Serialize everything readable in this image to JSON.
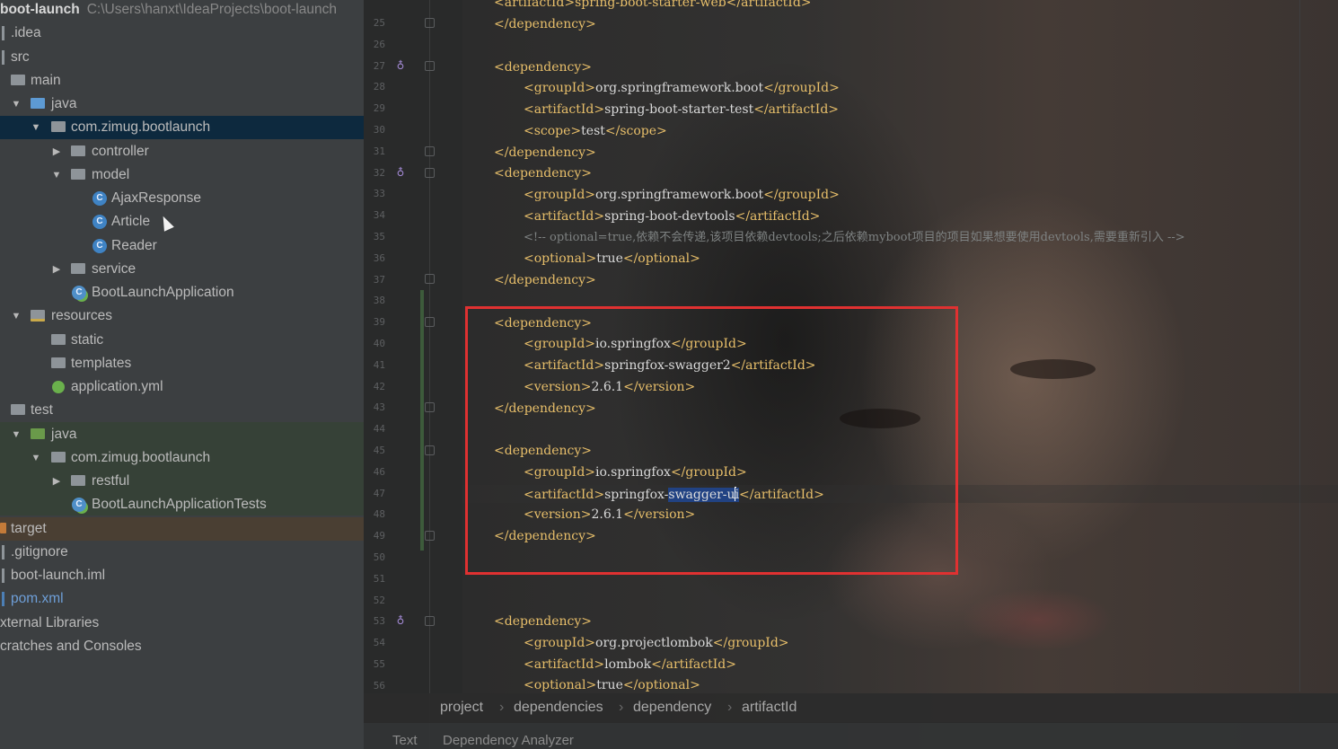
{
  "tree": {
    "root_name": "boot-launch",
    "root_path": "C:\\Users\\hanxt\\IdeaProjects\\boot-launch",
    "items": [
      {
        "label": "Idea",
        "display": ".idea"
      },
      {
        "label": "src"
      },
      {
        "label": "main"
      },
      {
        "label": "java"
      },
      {
        "label": "com.zimug.bootlaunch"
      },
      {
        "label": "controller"
      },
      {
        "label": "model"
      },
      {
        "label": "AjaxResponse"
      },
      {
        "label": "Article"
      },
      {
        "label": "Reader"
      },
      {
        "label": "service"
      },
      {
        "label": "BootLaunchApplication"
      },
      {
        "label": "resources"
      },
      {
        "label": "static"
      },
      {
        "label": "templates"
      },
      {
        "label": "application.yml"
      },
      {
        "label": "test"
      },
      {
        "label": "java"
      },
      {
        "label": "com.zimug.bootlaunch"
      },
      {
        "label": "restful"
      },
      {
        "label": "BootLaunchApplicationTests"
      },
      {
        "label": "target"
      },
      {
        "label": ".gitignore"
      },
      {
        "label": "boot-launch.iml"
      },
      {
        "label": "pom.xml"
      },
      {
        "label": "xternal Libraries"
      },
      {
        "label": "cratches and Consoles"
      }
    ]
  },
  "editor": {
    "line_numbers": [
      "25",
      "26",
      "27",
      "28",
      "29",
      "30",
      "31",
      "32",
      "33",
      "34",
      "35",
      "36",
      "37",
      "38",
      "39",
      "40",
      "41",
      "42",
      "43",
      "44",
      "45",
      "46",
      "47",
      "48",
      "49",
      "50",
      "51",
      "52",
      "53",
      "54",
      "55",
      "56"
    ],
    "lines": {
      "l24": "<artifactId>spring-boot-starter-web</artifactId>",
      "l25": "</dependency>",
      "l27": "<dependency>",
      "l28a": "<groupId>",
      "l28b": "org.springframework.boot",
      "l28c": "</groupId>",
      "l29a": "<artifactId>",
      "l29b": "spring-boot-starter-test",
      "l29c": "</artifactId>",
      "l30a": "<scope>",
      "l30b": "test",
      "l30c": "</scope>",
      "l31": "</dependency>",
      "l32": "<dependency>",
      "l33a": "<groupId>",
      "l33b": "org.springframework.boot",
      "l33c": "</groupId>",
      "l34a": "<artifactId>",
      "l34b": "spring-boot-devtools",
      "l34c": "</artifactId>",
      "l35": "<!-- optional=true,依赖不会传递,该项目依赖devtools;之后依赖myboot项目的项目如果想要使用devtools,需要重新引入 -->",
      "l36a": "<optional>",
      "l36b": "true",
      "l36c": "</optional>",
      "l37": "</dependency>",
      "l39": "<dependency>",
      "l40a": "<groupId>",
      "l40b": "io.springfox",
      "l40c": "</groupId>",
      "l41a": "<artifactId>",
      "l41b": "springfox-swagger2",
      "l41c": "</artifactId>",
      "l42a": "<version>",
      "l42b": "2.6.1",
      "l42c": "</version>",
      "l43": "</dependency>",
      "l45": "<dependency>",
      "l46a": "<groupId>",
      "l46b": "io.springfox",
      "l46c": "</groupId>",
      "l47a": "<artifactId>",
      "l47b": "springfox-",
      "l47sel1": "swagger-u",
      "l47sel2": "i",
      "l47c": "</artifactId>",
      "l48a": "<version>",
      "l48b": "2.6.1",
      "l48c": "</version>",
      "l49": "</dependency>",
      "l53": "<dependency>",
      "l54a": "<groupId>",
      "l54b": "org.projectlombok",
      "l54c": "</groupId>",
      "l55a": "<artifactId>",
      "l55b": "lombok",
      "l55c": "</artifactId>",
      "l56a": "<optional>",
      "l56b": "true",
      "l56c": "</optional>"
    }
  },
  "breadcrumb": [
    "project",
    "dependencies",
    "dependency",
    "artifactId"
  ],
  "bottom_tabs": [
    "Text",
    "Dependency Analyzer"
  ],
  "colors": {
    "tree_bg": "#3c3f41",
    "selection": "#0d293e",
    "tag": "#e8bf6a",
    "highlight_box": "#e03131"
  }
}
